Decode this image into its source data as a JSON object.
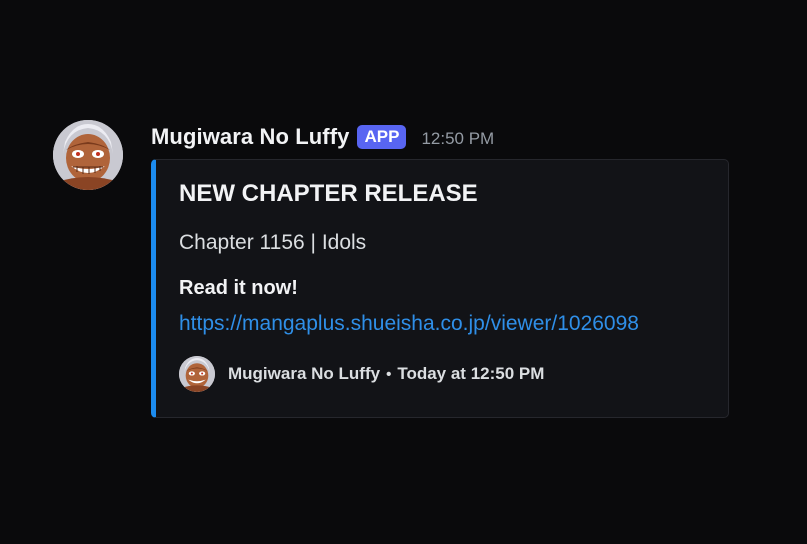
{
  "message": {
    "author": "Mugiwara No Luffy",
    "tag": "APP",
    "timestamp": "12:50 PM",
    "avatar_icon": "luffy-gear5-avatar"
  },
  "embed": {
    "accent_color": "#1c8cf0",
    "title": "NEW CHAPTER RELEASE",
    "description": "Chapter 1156 | Idols",
    "field_name": "Read it now!",
    "link": "https://mangaplus.shueisha.co.jp/viewer/1026098",
    "footer": {
      "author": "Mugiwara No Luffy",
      "separator": "•",
      "time": "Today at 12:50 PM"
    }
  },
  "colors": {
    "background": "#0a0a0c",
    "app_tag": "#5865f2",
    "link": "#2f8fe8"
  }
}
